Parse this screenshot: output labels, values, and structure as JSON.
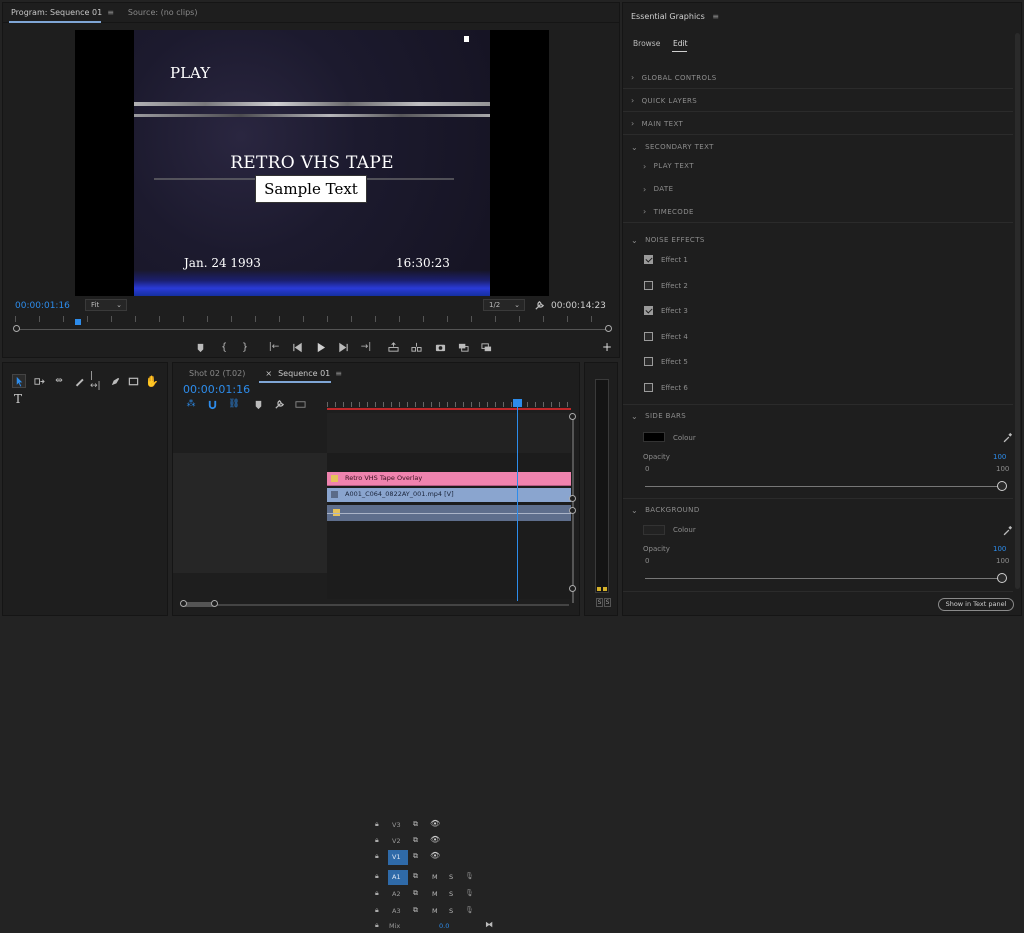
{
  "program_panel": {
    "tabs": [
      "Program: Sequence 01",
      "Source: (no clips)"
    ],
    "video": {
      "play": "PLAY",
      "title": "RETRO VHS TAPE",
      "sample": "Sample Text",
      "date": "Jan. 24 1993",
      "time": "16:30:23"
    },
    "timecode_current": "00:00:01:16",
    "fit_label": "Fit",
    "resolution_label": "1/2",
    "timecode_duration": "00:00:14:23",
    "playhead_progress": 0.105
  },
  "timeline_panel": {
    "tabs": [
      "Shot 02 (T.02)",
      "Sequence 01"
    ],
    "tab_close": "×",
    "timecode": "00:00:01:16",
    "tracks_video": [
      {
        "name": "V3",
        "target": false
      },
      {
        "name": "V2",
        "target": false
      },
      {
        "name": "V1",
        "target": true
      }
    ],
    "tracks_audio": [
      {
        "name": "A1",
        "target": true
      },
      {
        "name": "A2",
        "target": false
      },
      {
        "name": "A3",
        "target": false
      }
    ],
    "track_m": "M",
    "track_s": "S",
    "mix_label": "Mix",
    "mix_value": "0.0",
    "clips": {
      "overlay": "Retro VHS Tape Overlay",
      "video": "A001_C064_0822AY_001.mp4 [V]"
    },
    "playhead_position": 0.78,
    "meter_labels": [
      "S",
      "S"
    ]
  },
  "essential_graphics": {
    "title": "Essential Graphics",
    "tabs": [
      "Browse",
      "Edit"
    ],
    "sections": {
      "global_controls": "GLOBAL CONTROLS",
      "quick_layers": "QUICK LAYERS",
      "main_text": "MAIN TEXT",
      "secondary_text": "SECONDARY TEXT",
      "play_text": "PLAY TEXT",
      "date": "DATE",
      "timecode": "TIMECODE",
      "noise_effects": "NOISE EFFECTS",
      "side_bars": "SIDE BARS",
      "background": "BACKGROUND"
    },
    "effects": [
      {
        "label": "Effect 1",
        "checked": true
      },
      {
        "label": "Effect 2",
        "checked": false
      },
      {
        "label": "Effect 3",
        "checked": true
      },
      {
        "label": "Effect 4",
        "checked": false
      },
      {
        "label": "Effect 5",
        "checked": false
      },
      {
        "label": "Effect 6",
        "checked": false
      }
    ],
    "side_bars": {
      "colour_label": "Colour",
      "colour": "#000000",
      "opacity_label": "Opacity",
      "opacity_value": "100",
      "min": "0",
      "max": "100"
    },
    "background": {
      "colour_label": "Colour",
      "colour": "#222222",
      "opacity_label": "Opacity",
      "opacity_value": "100",
      "min": "0",
      "max": "100"
    },
    "show_in_text_panel": "Show in Text panel"
  }
}
